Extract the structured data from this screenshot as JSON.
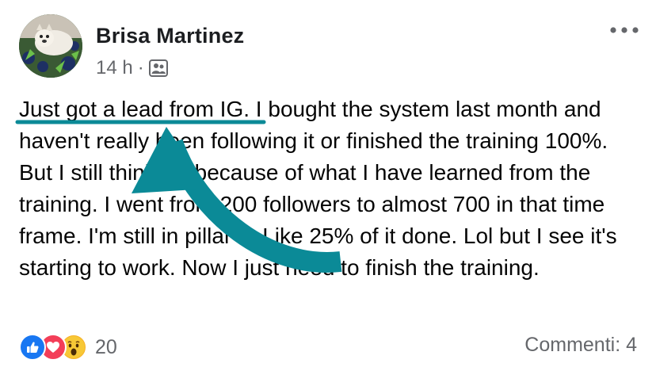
{
  "post": {
    "author": "Brisa Martinez",
    "time": "14 h",
    "separator": "·",
    "audience_icon": "friends-icon",
    "highlighted_text": "Just got a lead from IG",
    "body_text": ". I bought the system last month and haven't really been following it or finished the training 100%. But I still think it's because of what I have learned from the training. I went from 200 followers to almost 700 in that time frame. I'm still in pillar 2. Like 25% of it done. Lol but I see it's starting to work. Now I just need to finish the training."
  },
  "annotation": {
    "color": "#0b8a97",
    "type": "curved-arrow-and-underline"
  },
  "reactions": {
    "icons": [
      "like-icon",
      "love-icon",
      "wow-icon"
    ],
    "count": "20"
  },
  "comments": {
    "label": "Commenti: 4"
  },
  "colors": {
    "like": "#1877f2",
    "love": "#f33e58",
    "wow": "#f7b125",
    "muted": "#65676b",
    "text": "#050505"
  }
}
